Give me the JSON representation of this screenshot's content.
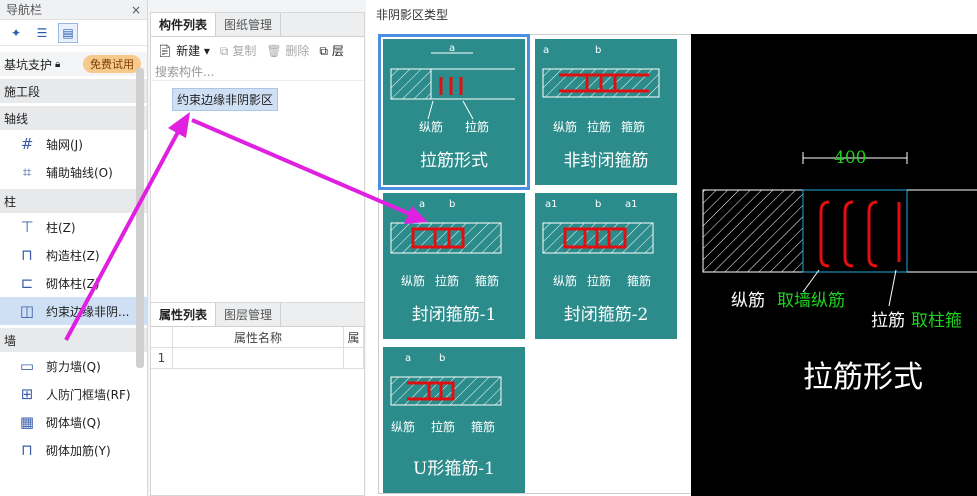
{
  "nav": {
    "title": "导航栏",
    "close": "×",
    "categories": [
      {
        "label": "基坑支护",
        "badge": "免费试用"
      },
      {
        "label": "施工段"
      },
      {
        "label": "轴线"
      },
      {
        "label": "柱"
      },
      {
        "label": "墙"
      }
    ],
    "items": [
      "轴网(J)",
      "辅助轴线(O)",
      "柱(Z)",
      "构造柱(Z)",
      "砌体柱(Z)",
      "约束边缘非阴...",
      "剪力墙(Q)",
      "人防门框墙(RF)",
      "砌体墙(Q)",
      "砌体加筋(Y)"
    ]
  },
  "mid": {
    "tabs": [
      "构件列表",
      "图纸管理"
    ],
    "new": "新建",
    "copy": "复制",
    "delete": "删除",
    "layer": "层",
    "search": "搜索构件...",
    "component": "约束边缘非阴影区"
  },
  "prop": {
    "tabs": [
      "属性列表",
      "图层管理"
    ],
    "col": "属性名称",
    "col2": "属",
    "row": "1"
  },
  "dialog": {
    "title": "非阴影区类型",
    "cells": [
      "拉筋形式",
      "非封闭箍筋",
      "封闭箍筋-1",
      "封闭箍筋-2",
      "U形箍筋-1"
    ],
    "labels": {
      "a": "a",
      "b": "b",
      "a1": "a1",
      "zj": "纵筋",
      "lj": "拉筋",
      "gj": "箍筋"
    },
    "preview": {
      "dim": "400",
      "zj": "纵筋",
      "zj2": "取墙纵筋",
      "lj": "拉筋",
      "lj2": "取柱箍",
      "title": "拉筋形式"
    }
  },
  "colors": {
    "accent": "#2b8c8b",
    "arrow": "#e020e0",
    "rebar": "#e01010",
    "green": "#20d020"
  }
}
